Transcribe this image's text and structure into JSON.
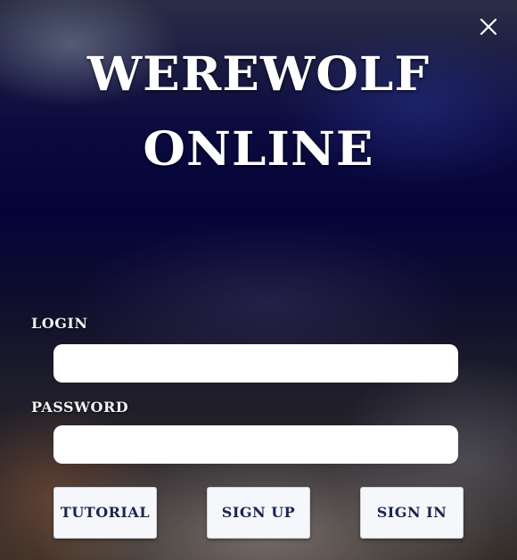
{
  "header": {
    "close_icon": "close-icon"
  },
  "title": {
    "line1": "WEREWOLF",
    "line2": "ONLINE"
  },
  "form": {
    "login_label": "LOGIN",
    "login_value": "",
    "password_label": "PASSWORD",
    "password_value": ""
  },
  "buttons": {
    "tutorial": "TUTORIAL",
    "sign_up": "SIGN UP",
    "sign_in": "SIGN IN"
  },
  "colors": {
    "button_text": "#1c2450",
    "title_text": "#ffffff",
    "background_dark": "#05043a"
  }
}
